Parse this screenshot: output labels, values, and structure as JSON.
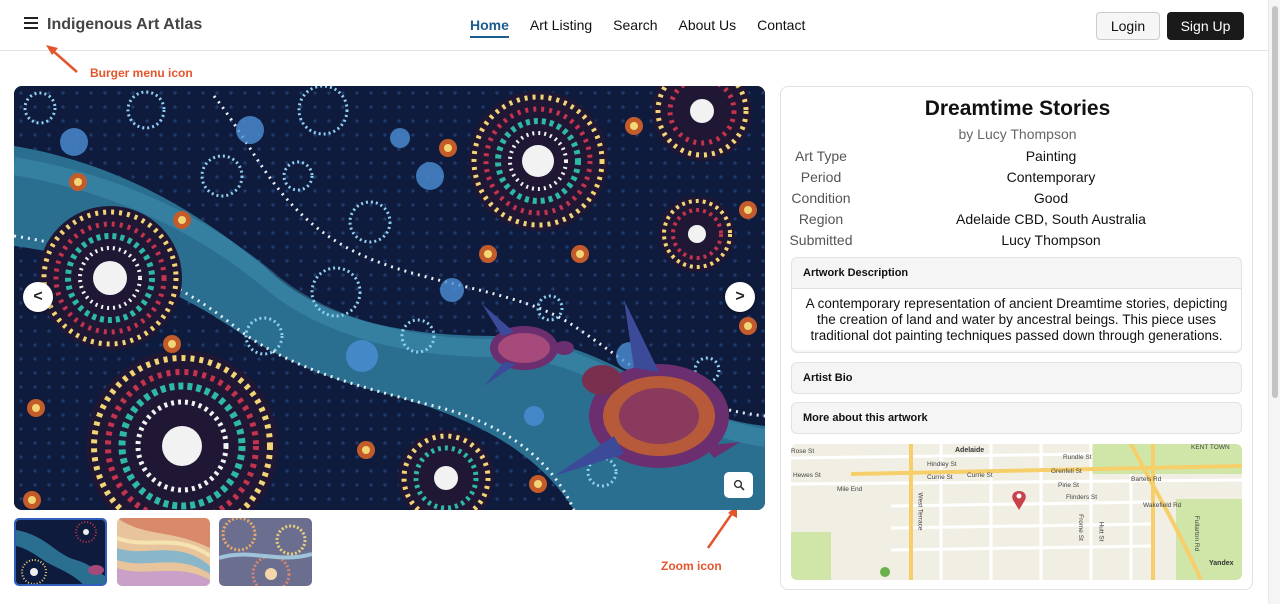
{
  "header": {
    "brand": "Indigenous Art Atlas",
    "nav": [
      {
        "label": "Home",
        "active": true
      },
      {
        "label": "Art Listing",
        "active": false
      },
      {
        "label": "Search",
        "active": false
      },
      {
        "label": "About Us",
        "active": false
      },
      {
        "label": "Contact",
        "active": false
      }
    ],
    "login_label": "Login",
    "signup_label": "Sign Up",
    "menu_icon": "burger-menu-icon"
  },
  "annotations": {
    "burger": "Burger menu icon",
    "zoom": "Zoom icon",
    "color": "#e4552c"
  },
  "gallery": {
    "prev_label": "<",
    "next_label": ">",
    "zoom_icon": "magnifier-icon",
    "thumbnails": 3,
    "active_thumbnail": 1
  },
  "artwork": {
    "title": "Dreamtime Stories",
    "artist": "by Lucy Thompson",
    "details": [
      {
        "label": "Art Type",
        "value": "Painting"
      },
      {
        "label": "Period",
        "value": "Contemporary"
      },
      {
        "label": "Condition",
        "value": "Good"
      },
      {
        "label": "Region",
        "value": "Adelaide CBD, South Australia"
      },
      {
        "label": "Submitted",
        "value": "Lucy Thompson"
      }
    ],
    "description_title": "Artwork Description",
    "description": "A contemporary representation of ancient Dreamtime stories, depicting the creation of land and water by ancestral beings. This piece uses traditional dot painting techniques passed down through generations.",
    "artist_bio_title": "Artist Bio",
    "more_title": "More about this artwork"
  },
  "map": {
    "labels": [
      "Adelaide",
      "Rose St",
      "Hindley St",
      "Currie St",
      "Currie St",
      "Rundle St",
      "Grenfell St",
      "Pirie St",
      "Flinders St",
      "Bartels Rd",
      "Wakefield Rd",
      "Hewes St",
      "Mile End",
      "West Terrace",
      "Frome St",
      "Hutt St",
      "Fullarton Rd",
      "KENT TOWN",
      "Yandex"
    ],
    "attribution": "Yandex",
    "colors": {
      "background": "#f1efe4",
      "major_road": "#f6cf6a",
      "park": "#cfe6a8",
      "pin": "#c8414b"
    }
  },
  "colors": {
    "accent": "#1a5d8f",
    "signup_bg": "#1a1a1a",
    "thumb_border": "#2f5fb8"
  }
}
